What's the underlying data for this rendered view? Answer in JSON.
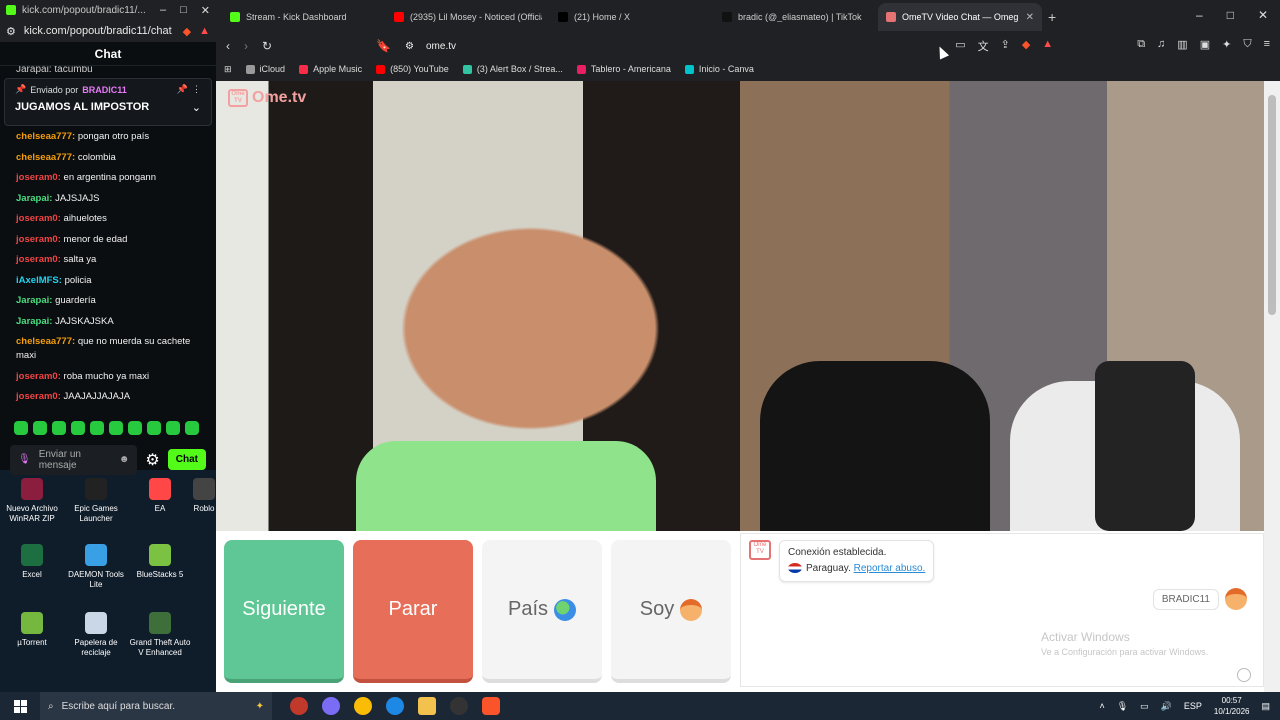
{
  "chat_window": {
    "tab_title": "kick.com/popout/bradic11/...",
    "url": "kick.com/popout/bradic11/chat",
    "header": "Chat",
    "top_partial_msg": "Jarapai: tacumbu",
    "pinned": {
      "sent_by_label": "Enviado por",
      "user": "BRADIC11",
      "text": "JUGAMOS AL IMPOSTOR"
    },
    "messages": [
      {
        "user": "chelseaa777:",
        "text": "pongan otro país",
        "color": "#f59e0b"
      },
      {
        "user": "chelseaa777:",
        "text": "colombia",
        "color": "#f59e0b"
      },
      {
        "user": "joseram0:",
        "text": "en argentina pongann",
        "color": "#ef4444"
      },
      {
        "user": "Jarapai:",
        "text": "JAJSJAJS",
        "color": "#4ade80"
      },
      {
        "user": "joseram0:",
        "text": "aihuelotes",
        "color": "#ef4444"
      },
      {
        "user": "joseram0:",
        "text": "menor de edad",
        "color": "#ef4444"
      },
      {
        "user": "joseram0:",
        "text": "salta ya",
        "color": "#ef4444"
      },
      {
        "user": "iAxelMFS:",
        "text": "policia",
        "color": "#22d3ee"
      },
      {
        "user": "Jarapai:",
        "text": "guardería",
        "color": "#4ade80"
      },
      {
        "user": "Jarapai:",
        "text": "JAJSKAJSKA",
        "color": "#4ade80"
      },
      {
        "user": "chelseaa777:",
        "text": "que no muerda su cachete maxi",
        "color": "#f59e0b"
      },
      {
        "user": "joseram0:",
        "text": "roba mucho ya maxi",
        "color": "#ef4444"
      },
      {
        "user": "joseram0:",
        "text": "JAAJAJJAJAJA",
        "color": "#ef4444"
      }
    ],
    "input_placeholder": "Enviar un mensaje",
    "send_label": "Chat"
  },
  "desktop_icons": [
    {
      "label": "Nuevo Archivo WinRAR ZIP",
      "color": "#8b1e3f"
    },
    {
      "label": "Epic Games Launcher",
      "color": "#222"
    },
    {
      "label": "EA",
      "color": "#ff4747"
    },
    {
      "label": "Roblo",
      "color": "#444"
    },
    {
      "label": "Excel",
      "color": "#1d6f42"
    },
    {
      "label": "DAEMON Tools Lite",
      "color": "#3aa0e6"
    },
    {
      "label": "BlueStacks 5",
      "color": "#7cc242"
    },
    {
      "label": "µTorrent",
      "color": "#76b83f"
    },
    {
      "label": "Papelera de reciclaje",
      "color": "#c9d7e6"
    },
    {
      "label": "Grand Theft Auto V Enhanced",
      "color": "#3e6f3a"
    }
  ],
  "browser": {
    "tabs": [
      {
        "label": "Stream - Kick Dashboard",
        "color": "#53fc18",
        "active": false
      },
      {
        "label": "(2935) Lil Mosey - Noticed (Official M",
        "color": "#ff0000",
        "active": false
      },
      {
        "label": "(21) Home / X",
        "color": "#000000",
        "active": false
      },
      {
        "label": "bradic (@_eliasmateo) | TikTok",
        "color": "#111111",
        "active": false
      },
      {
        "label": "OmeTV Video Chat — Omeg",
        "color": "#e57373",
        "active": true
      }
    ],
    "url": "ome.tv",
    "bookmarks": [
      {
        "label": "iCloud",
        "color": "#999"
      },
      {
        "label": "Apple Music",
        "color": "#fa2d48"
      },
      {
        "label": "(850) YouTube",
        "color": "#ff0000"
      },
      {
        "label": "(3) Alert Box / Strea...",
        "color": "#31c3a2"
      },
      {
        "label": "Tablero - Americana",
        "color": "#e91e63"
      },
      {
        "label": "Inicio - Canva",
        "color": "#00c4cc"
      }
    ]
  },
  "ometv": {
    "logo": "Ome.tv",
    "logo_small": "Ome TV",
    "buttons": {
      "next": "Siguiente",
      "stop": "Parar",
      "country": "País",
      "me": "Soy"
    },
    "system_msg": {
      "line1": "Conexión establecida.",
      "country": "Paraguay.",
      "report": "Reportar abuso."
    },
    "my_name": "BRADIC11",
    "watermark_title": "Activar Windows",
    "watermark_sub": "Ve a Configuración para activar Windows."
  },
  "taskbar": {
    "search_placeholder": "Escribe aquí para buscar.",
    "lang": "ESP",
    "time": "00:57",
    "date": "10/1/2026"
  }
}
